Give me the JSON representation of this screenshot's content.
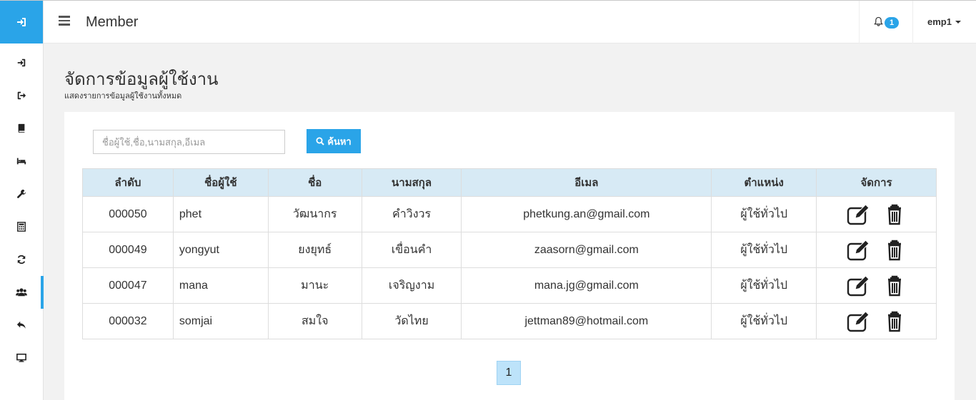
{
  "header": {
    "title": "Member",
    "notification_count": "1",
    "user": "emp1"
  },
  "page": {
    "title": "จัดการข้อมูลผู้ใช้งาน",
    "subtitle": "แสดงรายการข้อมูลผู้ใช้งานทั้งหมด"
  },
  "search": {
    "placeholder": "ชื่อผู้ใช้,ชื่อ,นามสกุล,อีเมล",
    "value": "",
    "button_label": "ค้นหา"
  },
  "table": {
    "columns": [
      "ลำดับ",
      "ชื่อผู้ใช้",
      "ชื่อ",
      "นามสกุล",
      "อีเมล",
      "ตำแหน่ง",
      "จัดการ"
    ],
    "rows": [
      [
        "000050",
        "phet",
        "วัฒนากร",
        "คำวิงวร",
        "phetkung.an@gmail.com",
        "ผู้ใช้ทั่วไป"
      ],
      [
        "000049",
        "yongyut",
        "ยงยุทธ์",
        "เขื่อนคำ",
        "zaasorn@gmail.com",
        "ผู้ใช้ทั่วไป"
      ],
      [
        "000047",
        "mana",
        "มานะ",
        "เจริญงาม",
        "mana.jg@gmail.com",
        "ผู้ใช้ทั่วไป"
      ],
      [
        "000032",
        "somjai",
        "สมใจ",
        "วัดไทย",
        "jettman89@hotmail.com",
        "ผู้ใช้ทั่วไป"
      ]
    ]
  },
  "pagination": {
    "current_page": "1"
  },
  "sidebar": {
    "items": [
      {
        "icon": "sign-in-icon"
      },
      {
        "icon": "sign-out-icon"
      },
      {
        "icon": "book-icon"
      },
      {
        "icon": "bed-icon"
      },
      {
        "icon": "wrench-icon"
      },
      {
        "icon": "calculator-icon"
      },
      {
        "icon": "refresh-icon"
      },
      {
        "icon": "users-icon",
        "active": true
      },
      {
        "icon": "reply-icon"
      },
      {
        "icon": "desktop-icon"
      }
    ]
  },
  "colors": {
    "accent": "#2aa4e8",
    "table_header": "#d7eaf5",
    "page_bg": "#f2f2f2"
  }
}
